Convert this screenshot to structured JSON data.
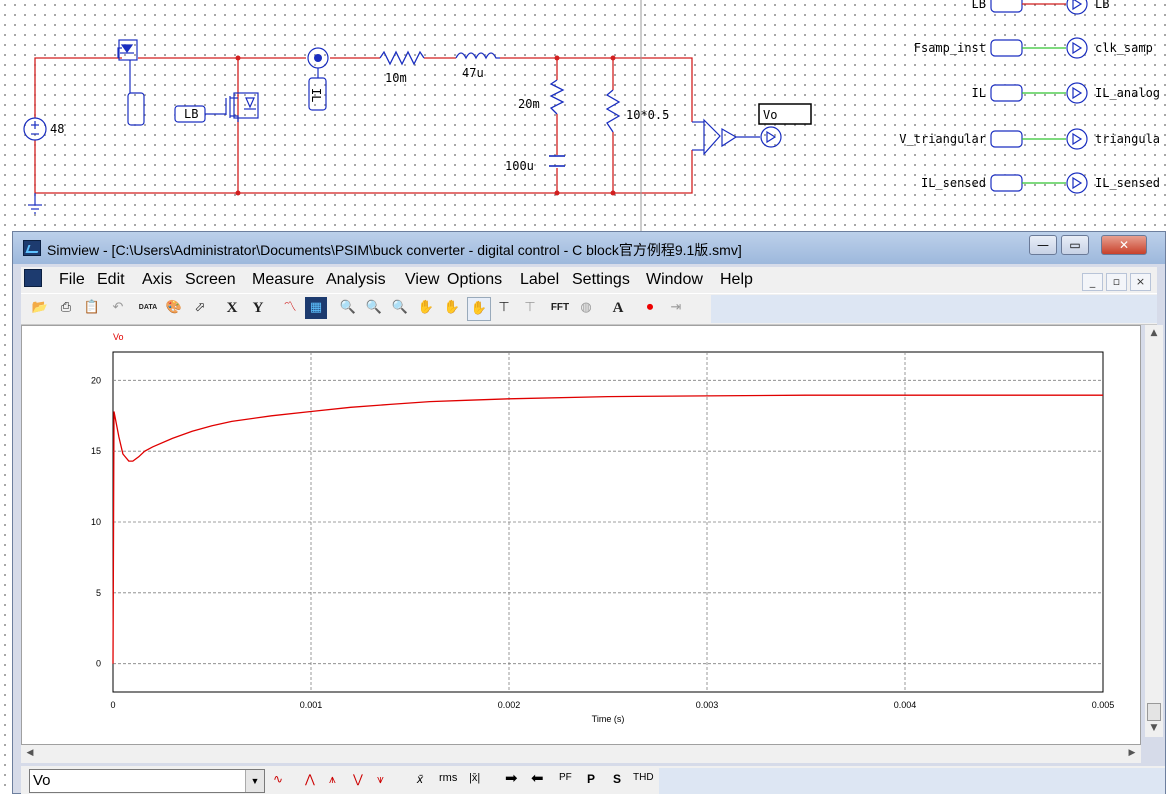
{
  "schematic": {
    "source_value": "48",
    "resistor_series": "10m",
    "inductor": "47u",
    "esr_resistor": "20m",
    "capacitor": "100u",
    "load_resistor": "10*0.5",
    "gate_label": "LB",
    "current_sensor_label": "IL",
    "diode_label": "LB",
    "vo_probe": "Vo",
    "signal_rows": [
      {
        "left": "LB",
        "right": "LB"
      },
      {
        "left": "Fsamp_inst",
        "right": "clk_samp"
      },
      {
        "left": "IL",
        "right": "IL_analog"
      },
      {
        "left": "V_triangular",
        "right": "triangula"
      },
      {
        "left": "IL_sensed",
        "right": "IL_sensed"
      }
    ]
  },
  "window": {
    "title": "Simview - [C:\\Users\\Administrator\\Documents\\PSIM\\buck converter - digital control - C block官方例程9.1版.smv]",
    "minimize": "—",
    "maximize": "▭",
    "close": "✕"
  },
  "menu": [
    "File",
    "Edit",
    "Axis",
    "Screen",
    "Measure",
    "Analysis",
    "View",
    "Options",
    "Label",
    "Settings",
    "Window",
    "Help"
  ],
  "toolbar": {
    "x_btn": "X",
    "y_btn": "Y",
    "fft_btn": "FFT",
    "text_btn": "A",
    "data_btn": "DATA"
  },
  "bottombar": {
    "selected_curve": "Vo",
    "xbar": "x̄",
    "rms": "rms",
    "absavg": "|x̄|",
    "pf": "PF",
    "p": "P",
    "s": "S",
    "thd": "THD"
  },
  "chart_data": {
    "type": "line",
    "title": "",
    "xlabel": "Time (s)",
    "ylabel": "",
    "xlim": [
      0,
      0.005
    ],
    "ylim": [
      -2,
      22
    ],
    "x_ticks": [
      "0",
      "0.001",
      "0.002",
      "0.003",
      "0.004",
      "0.005"
    ],
    "y_ticks": [
      "0",
      "5",
      "10",
      "15",
      "20"
    ],
    "grid": true,
    "series": [
      {
        "name": "Vo",
        "color": "#e00000",
        "x": [
          0,
          5e-06,
          3e-05,
          5e-05,
          8e-05,
          0.0001,
          0.00013,
          0.00016,
          0.0002,
          0.0003,
          0.0004,
          0.0005,
          0.0006,
          0.0008,
          0.001,
          0.0012,
          0.0014,
          0.0016,
          0.0018,
          0.002,
          0.0025,
          0.003,
          0.0035,
          0.004,
          0.0045,
          0.005
        ],
        "y": [
          0,
          17.8,
          16.0,
          14.8,
          14.3,
          14.3,
          14.6,
          15.0,
          15.3,
          15.9,
          16.4,
          16.8,
          17.1,
          17.5,
          17.8,
          18.1,
          18.3,
          18.5,
          18.6,
          18.7,
          18.85,
          18.9,
          18.95,
          18.95,
          18.95,
          18.95
        ]
      }
    ]
  }
}
